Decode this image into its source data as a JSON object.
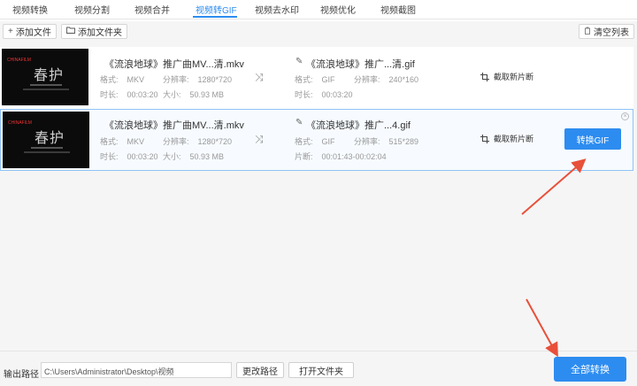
{
  "tabs": [
    {
      "label": "视频转换"
    },
    {
      "label": "视频分割"
    },
    {
      "label": "视频合并"
    },
    {
      "label": "视频转GIF",
      "active": true
    },
    {
      "label": "视频去水印"
    },
    {
      "label": "视频优化"
    },
    {
      "label": "视频截图"
    }
  ],
  "toolbar": {
    "add_file": "添加文件",
    "add_folder": "添加文件夹",
    "clear_list": "清空列表"
  },
  "labels": {
    "format": "格式:",
    "resolution": "分辨率:",
    "duration": "时长:",
    "size": "大小:",
    "segment": "片断:",
    "crop": "截取新片断",
    "convert_gif": "转换GIF"
  },
  "thumbnail": {
    "brand_part1": "CHINA",
    "brand_part2": "FILM",
    "title_glyph": "春护"
  },
  "files": [
    {
      "source_name": "《流浪地球》推广曲MV...清.mkv",
      "source_format": "MKV",
      "source_resolution": "1280*720",
      "source_duration": "00:03:20",
      "source_size": "50.93 MB",
      "output_name": "《流浪地球》推广...清.gif",
      "output_format": "GIF",
      "output_resolution": "240*160",
      "output_time_label": "时长:",
      "output_time": "00:03:20"
    },
    {
      "source_name": "《流浪地球》推广曲MV...清.mkv",
      "source_format": "MKV",
      "source_resolution": "1280*720",
      "source_duration": "00:03:20",
      "source_size": "50.93 MB",
      "output_name": "《流浪地球》推广...4.gif",
      "output_format": "GIF",
      "output_resolution": "515*289",
      "output_time_label": "片断:",
      "output_time": "00:01:43-00:02:04"
    }
  ],
  "bottom": {
    "output_path_label": "输出路径",
    "output_path": "C:\\Users\\Administrator\\Desktop\\视频",
    "change_path": "更改路径",
    "open_folder": "打开文件夹",
    "convert_all": "全部转换"
  },
  "colors": {
    "accent": "#2d8cf0",
    "annotation_arrow": "#e8503a"
  }
}
